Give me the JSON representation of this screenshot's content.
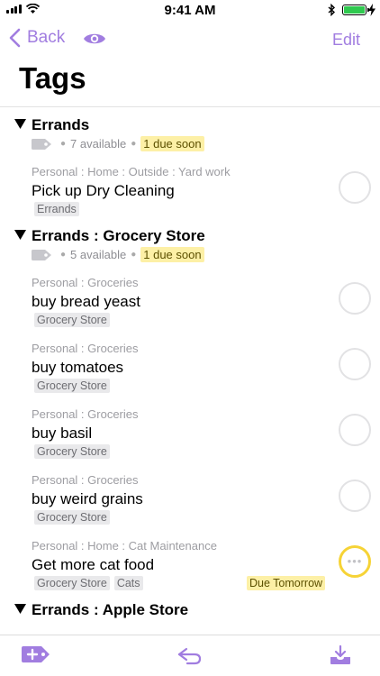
{
  "status_bar": {
    "time": "9:41 AM"
  },
  "nav": {
    "back_label": "Back",
    "edit_label": "Edit"
  },
  "page": {
    "title": "Tags"
  },
  "sections": [
    {
      "title": "Errands",
      "available": "7 available",
      "due_soon": "1 due soon"
    },
    {
      "title": "Errands : Grocery Store",
      "available": "5 available",
      "due_soon": "1 due soon"
    },
    {
      "title": "Errands : Apple Store"
    }
  ],
  "tasks": [
    {
      "path": "Personal : Home : Outside : Yard work",
      "title": "Pick up Dry Cleaning",
      "tags": [
        "Errands"
      ]
    },
    {
      "path": "Personal : Groceries",
      "title": "buy bread yeast",
      "tags": [
        "Grocery Store"
      ]
    },
    {
      "path": "Personal : Groceries",
      "title": "buy tomatoes",
      "tags": [
        "Grocery Store"
      ]
    },
    {
      "path": "Personal : Groceries",
      "title": "buy basil",
      "tags": [
        "Grocery Store"
      ]
    },
    {
      "path": "Personal : Groceries",
      "title": "buy weird grains",
      "tags": [
        "Grocery Store"
      ]
    },
    {
      "path": "Personal : Home : Cat Maintenance",
      "title": "Get more cat food",
      "tags": [
        "Grocery Store",
        "Cats"
      ],
      "due_flag": "Due Tomorrow",
      "status": "due"
    }
  ],
  "icons": {
    "back": "chevron-left-icon",
    "focus": "eye-icon",
    "add_tag": "tag-plus-icon",
    "undo": "undo-arrow-icon",
    "inbox": "inbox-tray-icon"
  },
  "colors": {
    "accent": "#a17de0",
    "due_soon_bg": "#fdf0a6",
    "due_ring": "#f6d336",
    "battery": "#2fc94f",
    "tag_chip_bg": "#e9e9eb"
  }
}
